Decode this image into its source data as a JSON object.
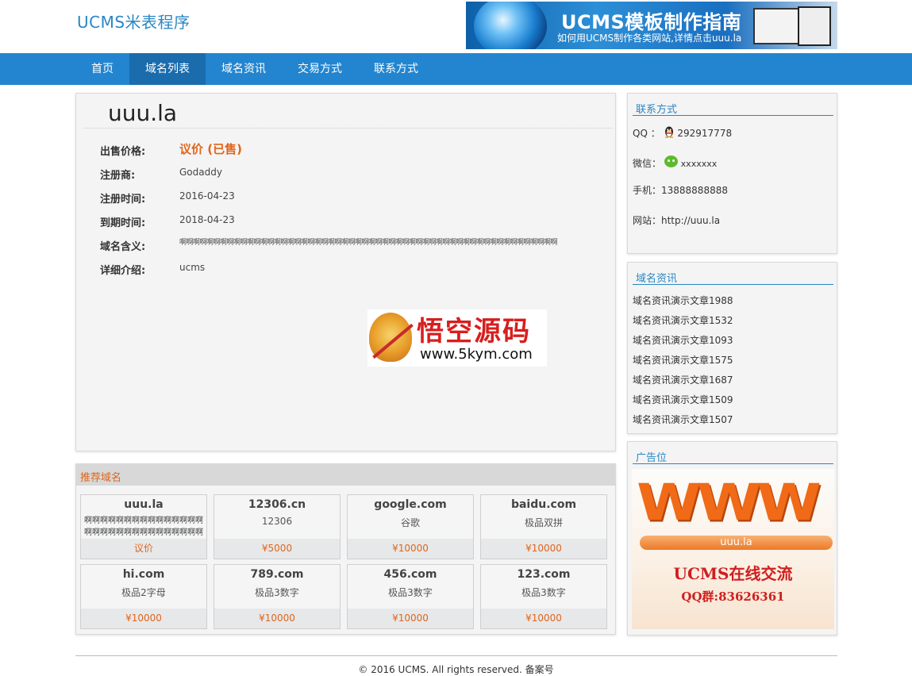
{
  "header": {
    "logo": "UCMS米表程序",
    "banner": {
      "title": "UCMS模板制作指南",
      "subtitle": "如何用UCMS制作各类网站,详情点击uuu.la"
    }
  },
  "nav": {
    "items": [
      {
        "label": "首页"
      },
      {
        "label": "域名列表",
        "active": true
      },
      {
        "label": "域名资讯"
      },
      {
        "label": "交易方式"
      },
      {
        "label": "联系方式"
      }
    ]
  },
  "domain": {
    "name": "uuu.la",
    "fields": [
      {
        "label": "出售价格:",
        "value": "议价 (已售)"
      },
      {
        "label": "注册商:",
        "value": "Godaddy"
      },
      {
        "label": "注册时间:",
        "value": "2016-04-23"
      },
      {
        "label": "到期时间:",
        "value": "2018-04-23"
      },
      {
        "label": "域名含义:",
        "value": "啊啊啊啊啊啊啊啊啊啊啊啊啊啊啊啊啊啊啊啊啊啊啊啊啊啊啊啊啊啊啊啊啊啊啊啊啊啊啊啊啊啊啊啊啊啊啊啊啊啊啊啊啊啊啊啊"
      },
      {
        "label": "详细介绍:",
        "value": "ucms"
      }
    ],
    "price_color": "#e0651b"
  },
  "watermark": {
    "cn": "悟空源码",
    "url": "www.5kym.com"
  },
  "recommend": {
    "title": "推荐域名",
    "cards": [
      {
        "name": "uuu.la",
        "desc": "啊啊啊啊啊啊啊啊啊啊啊啊啊啊啊啊啊啊啊啊啊啊啊啊啊啊啊啊啊啊",
        "price": "议价"
      },
      {
        "name": "12306.cn",
        "desc": "12306",
        "price": "¥5000"
      },
      {
        "name": "google.com",
        "desc": "谷歌",
        "price": "¥10000"
      },
      {
        "name": "baidu.com",
        "desc": "极品双拼",
        "price": "¥10000"
      },
      {
        "name": "hi.com",
        "desc": "极品2字母",
        "price": "¥10000"
      },
      {
        "name": "789.com",
        "desc": "极品3数字",
        "price": "¥10000"
      },
      {
        "name": "456.com",
        "desc": "极品3数字",
        "price": "¥10000"
      },
      {
        "name": "123.com",
        "desc": "极品3数字",
        "price": "¥10000"
      }
    ]
  },
  "contact": {
    "title": "联系方式",
    "qq_label": "QQ ：",
    "qq": "292917778",
    "wechat_label": "微信：",
    "wechat": "xxxxxxx",
    "phone": "手机：13888888888",
    "site": "网站：http://uuu.la"
  },
  "news": {
    "title": "域名资讯",
    "items": [
      "域名资讯演示文章1988",
      "域名资讯演示文章1532",
      "域名资讯演示文章1093",
      "域名资讯演示文章1575",
      "域名资讯演示文章1687",
      "域名资讯演示文章1509",
      "域名资讯演示文章1507"
    ]
  },
  "ad": {
    "title": "广告位",
    "big": "WWW",
    "bar": "uuu.la",
    "line1": "UCMS在线交流",
    "line2": "QQ群:83626361"
  },
  "footer": {
    "text": "© 2016 UCMS. All rights reserved. 备案号"
  },
  "colors": {
    "nav_bg": "#2385cf",
    "nav_active": "#1a6cad",
    "accent": "#2a87c4",
    "orange": "#e0651b"
  }
}
